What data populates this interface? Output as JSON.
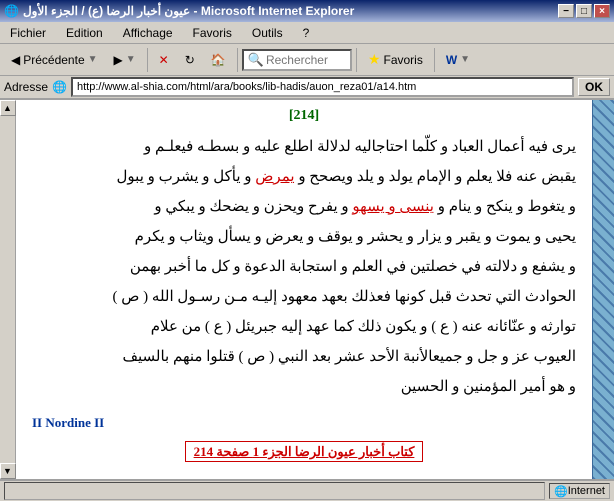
{
  "window": {
    "title": "عيون أخبار الرضا (ع) / الجزء الأول - Microsoft Internet Explorer",
    "icon": "🌐"
  },
  "menu": {
    "items": [
      "Fichier",
      "Edition",
      "Affichage",
      "Favoris",
      "Outils",
      "?"
    ]
  },
  "toolbar": {
    "back_label": "Précédente",
    "forward_icon": "▶",
    "stop_icon": "✕",
    "refresh_icon": "↻",
    "home_icon": "🏠",
    "search_placeholder": "Rechercher",
    "favorites_label": "Favoris",
    "w_icon": "W"
  },
  "address": {
    "label": "Adresse",
    "url": "http://www.al-shia.com/html/ara/books/lib-hadis/auon_reza01/a14.htm",
    "go_label": "OK"
  },
  "content": {
    "page_number": "[214]",
    "paragraphs": [
      "يرى فيه أعمال العباد و كلّما احتاجاليه لدلالة اطلع عليه و بسطـه فيعلـم و",
      "يقبض عنه فلا يعلم و الإمام يولد و يلد ويصحح و يمرض و يأكل و يشرب و يبول",
      "و يتغوط و ينكح و ينام و ينسى و يسهو و يفرح ويحزن و يضحك و يبكي و",
      "يحيى و يموت و يقبر و يزار و يحشر و يوقف و يعرض و يسأل ويثاب و يكرم",
      "و يشفع و دلالته في خصلتين في العلم و استجابة الدعوة و كل ما أخبر بهمن",
      "الحوادث التي تحدث قبل كونها فعذلك بعهد معهود إليـه مـن رسـول الله ( ص )",
      "توارثه و عنّائانه عنه ( ع ) و يكون ذلك كما عهد إليه جبريئل ( ع ) من علام",
      "العيوب عز و جل و جميعالأنبة الأحد عشر بعد النبي ( ص ) قتلوا منهم بالسيف",
      "و هو أمير المؤمنين و الحسين"
    ],
    "nordine": "II Nordine II",
    "bottom_link": "كتاب أخبار عيون الرضا الجزء 1 صفحة 214",
    "underline_words": [
      "يمرض",
      "ينسى و يسهو"
    ]
  },
  "status": {
    "text": "",
    "zone": "Internet"
  },
  "titlebar_buttons": {
    "minimize": "−",
    "maximize": "□",
    "close": "×"
  }
}
